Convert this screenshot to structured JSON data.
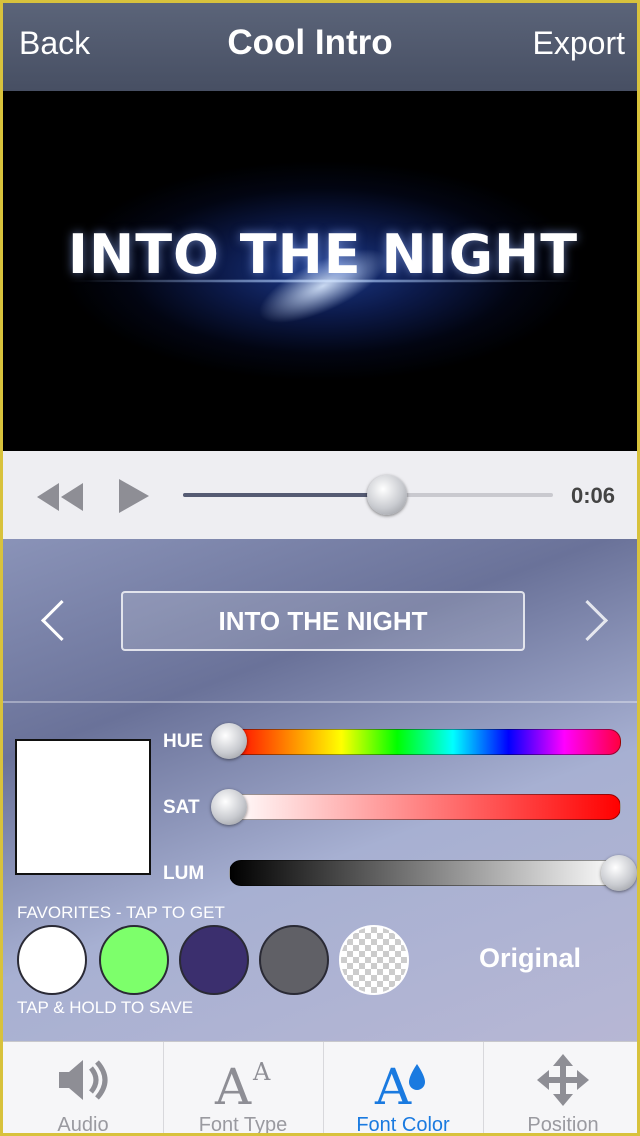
{
  "nav": {
    "back_label": "Back",
    "title": "Cool Intro",
    "export_label": "Export"
  },
  "video": {
    "overlay_text": "INTO THE NIGHT"
  },
  "player": {
    "time": "0:06",
    "progress": 0.55,
    "rewind_icon": "rewind-icon",
    "play_icon": "play-icon"
  },
  "editor": {
    "title_text": "INTO THE NIGHT",
    "prev_icon": "chevron-left-icon",
    "next_icon": "chevron-right-icon",
    "sliders": {
      "hue_label": "HUE",
      "hue_value": 0.0,
      "sat_label": "SAT",
      "sat_value": 0.0,
      "lum_label": "LUM",
      "lum_value": 1.0
    },
    "selected_color": "#ffffff",
    "favorites_label": "FAVORITES - TAP TO GET",
    "hold_label": "TAP & HOLD TO SAVE",
    "favorites": [
      "#ffffff",
      "#7dff6b",
      "#3b2f6e",
      "#606066",
      "transparent"
    ],
    "original_label": "Original"
  },
  "tabs": [
    {
      "label": "Audio",
      "icon": "speaker-icon",
      "active": false
    },
    {
      "label": "Font Type",
      "icon": "font-type-icon",
      "active": false
    },
    {
      "label": "Font Color",
      "icon": "font-color-icon",
      "active": true
    },
    {
      "label": "Position",
      "icon": "move-arrows-icon",
      "active": false
    }
  ],
  "colors": {
    "accent": "#1a7ae0",
    "nav_bg": "#4f576b"
  }
}
